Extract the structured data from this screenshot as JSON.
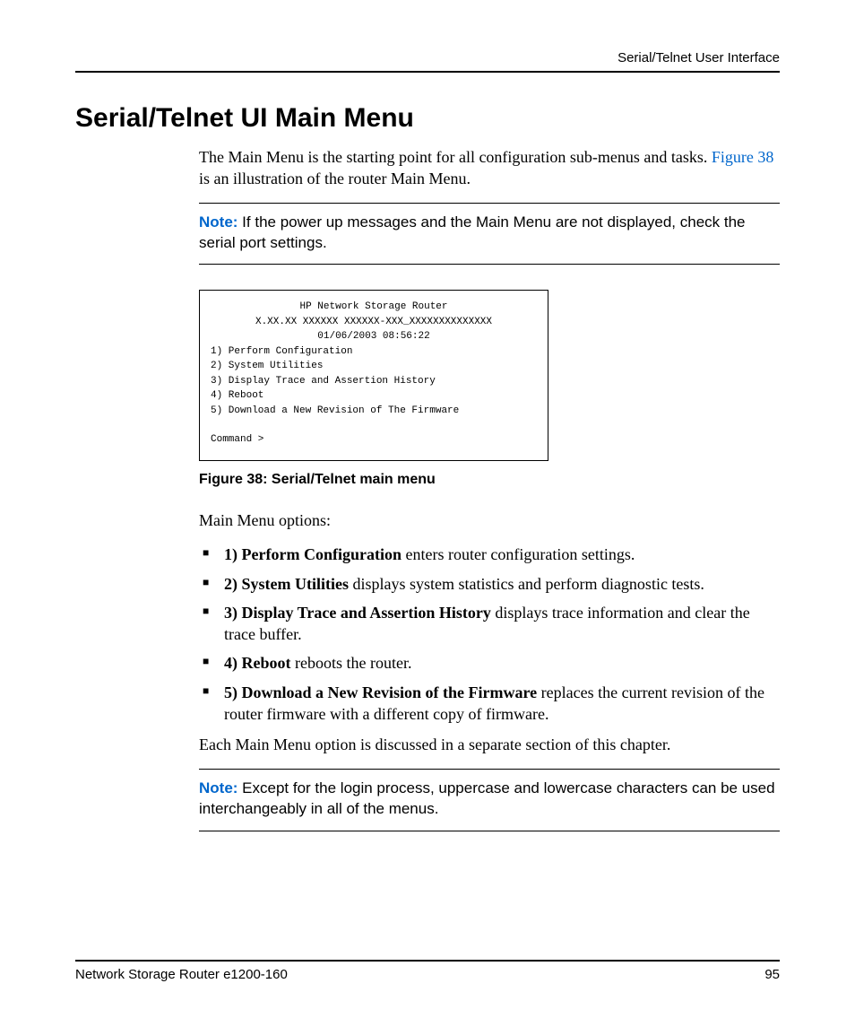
{
  "header": {
    "running": "Serial/Telnet User Interface"
  },
  "heading": "Serial/Telnet UI Main Menu",
  "intro": {
    "part1": "The Main Menu is the starting point for all configuration sub-menus and tasks. ",
    "figref": "Figure 38",
    "part2": " is an illustration of the router Main Menu."
  },
  "note1": {
    "label": "Note:",
    "text": "  If the power up messages and the Main Menu are not displayed, check the serial port settings."
  },
  "terminal": {
    "title": "HP Network Storage Router",
    "version": "X.XX.XX  XXXXXX  XXXXXX-XXX_XXXXXXXXXXXXXX",
    "datetime": "01/06/2003  08:56:22",
    "items": [
      "1) Perform Configuration",
      "2) System Utilities",
      "3) Display Trace and Assertion History",
      "4) Reboot",
      "5) Download a New Revision of The Firmware"
    ],
    "prompt": "Command >"
  },
  "figcap": "Figure 38:  Serial/Telnet main menu",
  "options_intro": "Main Menu options:",
  "options": [
    {
      "bold": "1) Perform Configuration",
      "rest": " enters router configuration settings."
    },
    {
      "bold": "2) System Utilities",
      "rest": " displays system statistics and perform diagnostic tests."
    },
    {
      "bold": "3) Display Trace and Assertion History",
      "rest": " displays trace information and clear the trace buffer."
    },
    {
      "bold": "4) Reboot",
      "rest": " reboots the router."
    },
    {
      "bold": "5) Download a New Revision of the Firmware",
      "rest": " replaces the current revision of the router firmware with a different copy of firmware."
    }
  ],
  "closing": "Each Main Menu option is discussed in a separate section of this chapter.",
  "note2": {
    "label": "Note:",
    "text": "  Except for the login process, uppercase and lowercase characters can be used interchangeably in all of the menus."
  },
  "footer": {
    "doc": "Network Storage Router e1200-160",
    "page": "95"
  }
}
